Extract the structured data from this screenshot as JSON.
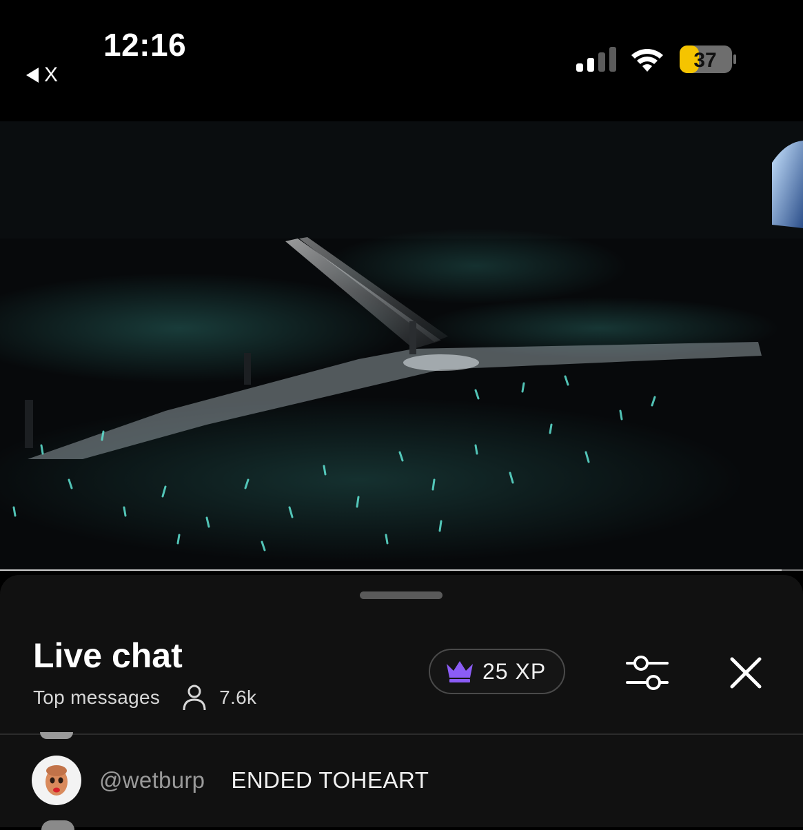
{
  "status_bar": {
    "time": "12:16",
    "back_app_label": "X",
    "battery_level": "37",
    "signal_bars_active": 2,
    "signal_bars_total": 4,
    "battery_fill_percent": 37,
    "battery_color": "#f5c400"
  },
  "video": {
    "playback_progress": 0.973,
    "icon": "concert-video-frame"
  },
  "live_chat": {
    "title": "Live chat",
    "mode_label": "Top messages",
    "viewer_count": "7.6k",
    "xp_label": "25 XP",
    "xp_icon": "crown-icon",
    "xp_icon_color": "#8b5cf6",
    "filter_icon": "sliders-icon",
    "close_icon": "close-icon"
  },
  "messages": [
    {
      "username": "@wetburp",
      "text": "ENDED TOHEART"
    }
  ]
}
